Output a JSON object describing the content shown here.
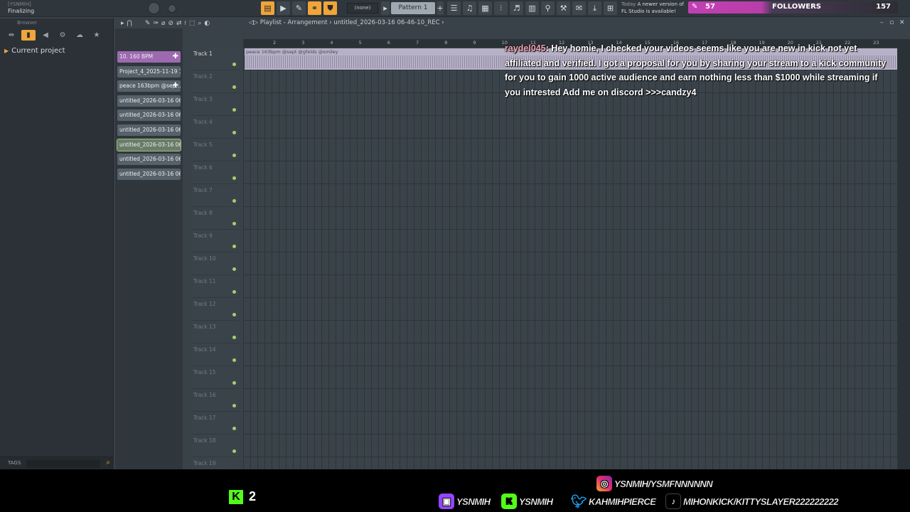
{
  "app": {
    "name": "[YSNMIH]",
    "status": "Finalizing"
  },
  "toolbar": {
    "pattern_selector": "(none)",
    "pattern_name": "Pattern 1",
    "news_line1_label": "Today",
    "news_line1": "A newer version of",
    "news_line2": "FL Studio is available!"
  },
  "followers": {
    "current": "57",
    "label": "FOLLOWERS",
    "goal": "157",
    "accent": "#c23fb3"
  },
  "browser": {
    "title": "Browser",
    "current_project": "Current project",
    "tags_label": "TAGS"
  },
  "patterns": [
    {
      "label": "10. 160 BPM",
      "color": "#9d6ab0",
      "has_plus": true
    },
    {
      "label": "Project_4_2025-11-19 1...",
      "color": "#56616a",
      "has_plus": false
    },
    {
      "label": "peace 163bpm @sep...",
      "color": "#56616a",
      "has_plus": true
    },
    {
      "label": "untitled_2026-03-16 06-...",
      "color": "#56616a",
      "has_plus": false
    },
    {
      "label": "untitled_2026-03-16 06-...",
      "color": "#56616a",
      "has_plus": false
    },
    {
      "label": "untitled_2026-03-16 06-...",
      "color": "#56616a",
      "has_plus": false
    },
    {
      "label": "untitled_2026-03-16 06-...",
      "color": "#6a7c6a",
      "has_plus": false
    },
    {
      "label": "untitled_2026-03-16 06-...",
      "color": "#56616a",
      "has_plus": false
    },
    {
      "label": "untitled_2026-03-16 06-...",
      "color": "#56616a",
      "has_plus": false
    }
  ],
  "playlist": {
    "title": "Playlist - Arrangement",
    "breadcrumb": "untitled_2026-03-16 06-46-10_REC",
    "clip_label": "peace 163bpm @sept @gfelds @smiley",
    "ruler": [
      "2",
      "3",
      "4",
      "5",
      "6",
      "7",
      "8",
      "9",
      "10",
      "11",
      "12",
      "13",
      "14",
      "15",
      "16",
      "17",
      "18",
      "19",
      "20",
      "21",
      "22",
      "23"
    ],
    "tracks": [
      "Track 1",
      "Track 2",
      "Track 3",
      "Track 4",
      "Track 5",
      "Track 6",
      "Track 7",
      "Track 8",
      "Track 9",
      "Track 10",
      "Track 11",
      "Track 12",
      "Track 13",
      "Track 14",
      "Track 15",
      "Track 16",
      "Track 17",
      "Track 18",
      "Track 19"
    ]
  },
  "chat": {
    "user": "raydel045",
    "message": ": Hey homie, I checked your videos seems like you are new in kick not yet affiliated and verified. I got a proposal for you by sharing your stream to a kick community for you to gain 1000 active audience and earn nothing less than $1000 while streaming if you intrested Add me on discord >>>candzy4"
  },
  "overlay": {
    "kick_viewers": "2",
    "instagram": "YSNMIH/YSMFNNNNNN",
    "twitch": "YSNMIH",
    "kick": "YSNMIH",
    "twitter": "KAHMIHPIERCE",
    "tiktok": "MIHONKICK/KITTYSLAYER222222222"
  }
}
